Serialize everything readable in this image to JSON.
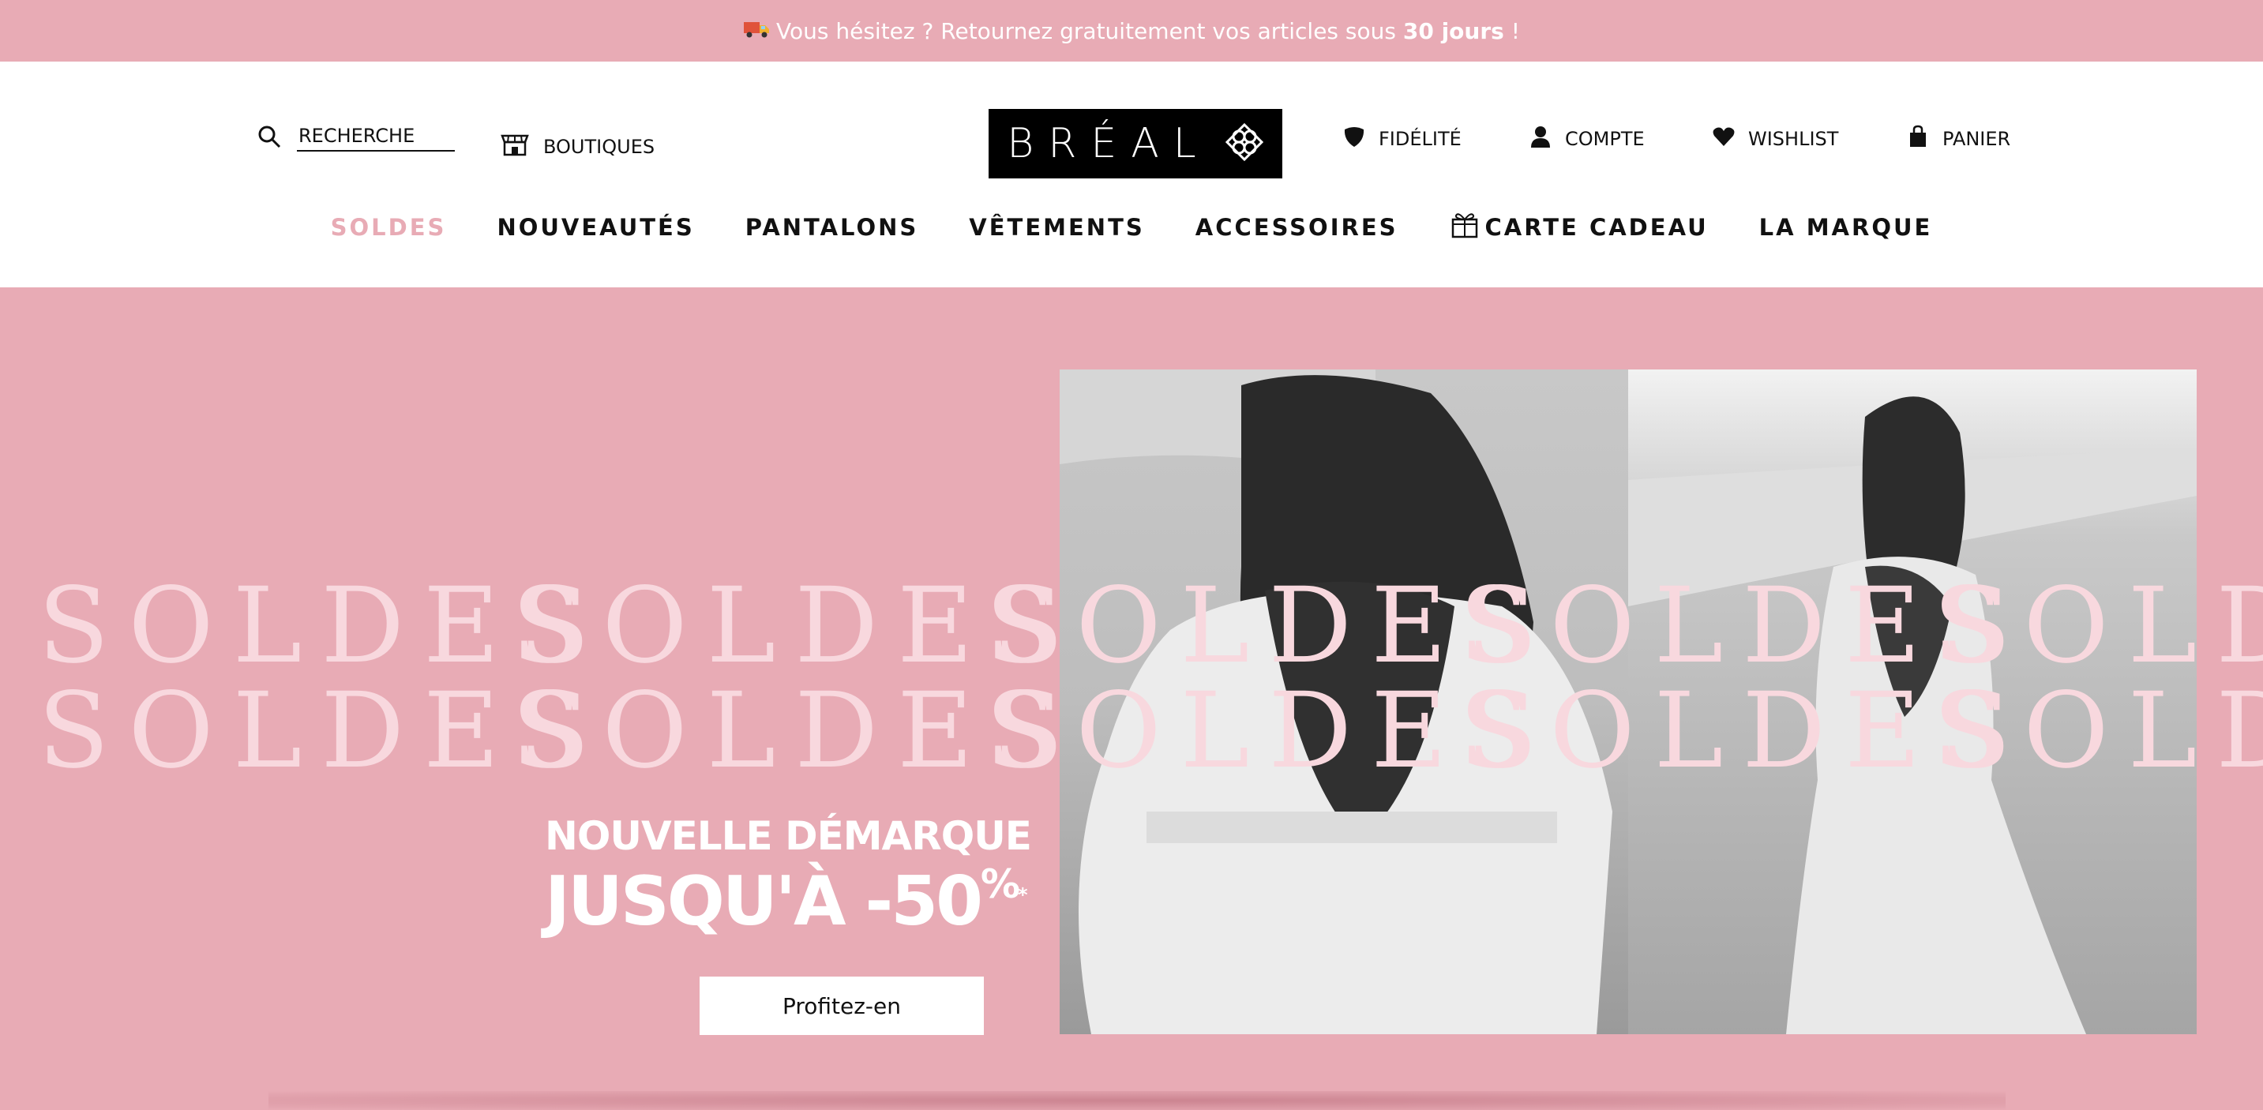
{
  "announcement": {
    "icon": "truck-icon",
    "text_before": "Vous hésitez ? Retournez gratuitement vos articles sous ",
    "text_bold": "30 jours",
    "text_after": " !"
  },
  "header": {
    "search_placeholder": "RECHERCHE",
    "boutiques_label": "BOUTIQUES",
    "logo_text": "BRÉAL",
    "fidelite_label": "FIDÉLITÉ",
    "compte_label": "COMPTE",
    "wishlist_label": "WISHLIST",
    "panier_label": "PANIER"
  },
  "nav": {
    "soldes": "SOLDES",
    "nouveautes": "NOUVEAUTÉS",
    "pantalons": "PANTALONS",
    "vetements": "VÊTEMENTS",
    "accessoires": "ACCESSOIRES",
    "carte_cadeau": "CARTE CADEAU",
    "la_marque": "LA MARQUE"
  },
  "hero": {
    "soldes_word": "SOLDES",
    "promo_line1": "NOUVELLE DÉMARQUE",
    "promo_line2": "JUSQU'À -50",
    "percent": "%",
    "asterisk": "*",
    "cta_label": "Profitez-en"
  },
  "colors": {
    "brand_pink": "#e8abb5",
    "soldes_text": "#f8d8de",
    "logo_bg": "#000000"
  }
}
